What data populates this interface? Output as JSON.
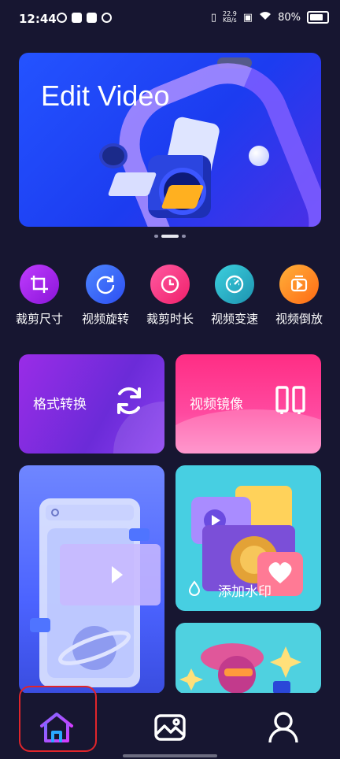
{
  "status_bar": {
    "time": "12:44",
    "net_speed_value": "22.9",
    "net_speed_unit": "KB/s",
    "battery": "80%"
  },
  "banner": {
    "title": "Edit Video",
    "page_count": 3,
    "active_page": 2
  },
  "tools": [
    {
      "label": "裁剪尺寸",
      "icon": "crop-icon",
      "color": "#a523e8"
    },
    {
      "label": "视频旋转",
      "icon": "rotate-icon",
      "color": "#3b6bff"
    },
    {
      "label": "裁剪时长",
      "icon": "clock-icon",
      "color": "#ff3d8a"
    },
    {
      "label": "视频变速",
      "icon": "speedometer-icon",
      "color": "#27b4c8"
    },
    {
      "label": "视频倒放",
      "icon": "reverse-play-icon",
      "color": "#ff8a1d"
    }
  ],
  "cards": {
    "format": {
      "label": "格式转换",
      "icon": "convert-arrows-icon"
    },
    "mirror": {
      "label": "视频镜像",
      "icon": "mirror-icon"
    },
    "watermark": {
      "label": "添加水印",
      "icon": "water-drop-icon"
    }
  },
  "nav": {
    "home": {
      "icon": "home-icon",
      "selected": true
    },
    "gallery": {
      "icon": "image-icon"
    },
    "profile": {
      "icon": "person-icon"
    }
  },
  "colors": {
    "background": "#171631",
    "highlight_box": "#e0252b"
  }
}
